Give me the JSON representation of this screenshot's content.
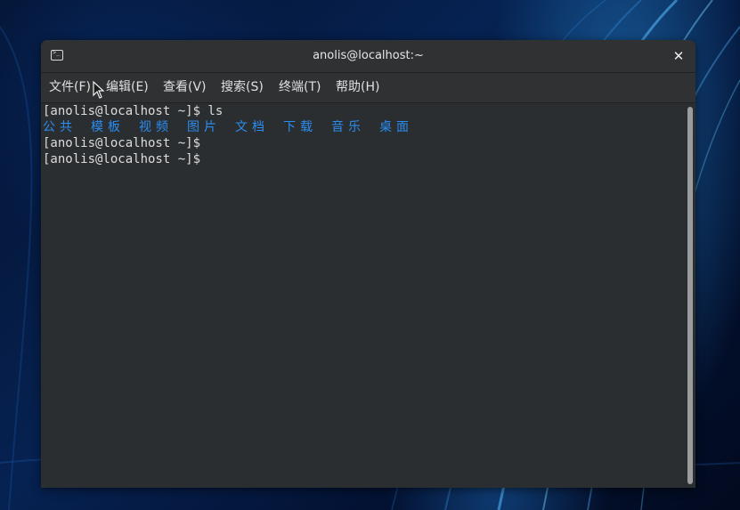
{
  "window": {
    "title": "anolis@localhost:~",
    "close_symbol": "✕",
    "icon": "terminal-icon",
    "icon_glyph": ">_"
  },
  "menu": {
    "items": [
      {
        "label": "文件(F)"
      },
      {
        "label": "编辑(E)"
      },
      {
        "label": "查看(V)"
      },
      {
        "label": "搜索(S)"
      },
      {
        "label": "终端(T)"
      },
      {
        "label": "帮助(H)"
      }
    ]
  },
  "terminal": {
    "lines": [
      "[anolis@localhost ~]$ ls",
      "",
      "[anolis@localhost ~]$",
      "[anolis@localhost ~]$"
    ],
    "ls_output": [
      "公共",
      "模板",
      "视频",
      "图片",
      "文档",
      "下载",
      "音乐",
      "桌面"
    ],
    "ls_color": "#2a8df0"
  },
  "colors": {
    "window_bg": "#2d2f31",
    "terminal_bg": "#2b2e30",
    "text": "#dcdcdc"
  }
}
